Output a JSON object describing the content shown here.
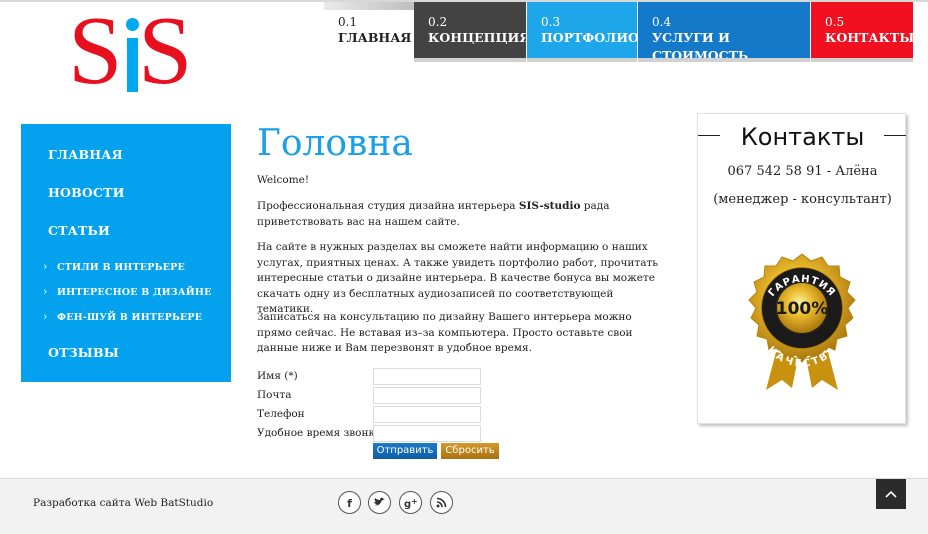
{
  "logo": {
    "text": "SiS"
  },
  "topnav": [
    {
      "num": "0.1",
      "label": "ГЛАВНАЯ"
    },
    {
      "num": "0.2",
      "label": "КОНЦЕПЦИЯ"
    },
    {
      "num": "0.3",
      "label": "ПОРТФОЛИО"
    },
    {
      "num": "0.4",
      "label": "УСЛУГИ И СТОИМОСТЬ"
    },
    {
      "num": "0.5",
      "label": "КОНТАКТЫ"
    }
  ],
  "sidebar": {
    "items": [
      {
        "label": "ГЛАВНАЯ"
      },
      {
        "label": "НОВОСТИ"
      },
      {
        "label": "СТАТЬИ"
      },
      {
        "label": "ОТЗЫВЫ"
      }
    ],
    "subitems": [
      {
        "label": "СТИЛИ В ИНТЕРЬЕРЕ"
      },
      {
        "label": "ИНТЕРЕСНОЕ В ДИЗАЙНЕ"
      },
      {
        "label": "ФЕН-ШУЙ В ИНТЕРЬЕРЕ"
      }
    ]
  },
  "main": {
    "title": "Головна",
    "welcome": "Welcome!",
    "p1_before": "Профессиональная студия дизайна интерьера ",
    "p1_brand": "SIS-studio",
    "p1_after": " рада приветствовать вас на нашем сайте.",
    "p2": "На сайте в нужных разделах вы сможете найти информацию о наших услугах, приятных ценах.    А также увидеть портфолио работ, прочитать интересные статьи о дизайне интерьера. В качестве бонуса вы можете скачать одну из бесплатных аудиозаписей по соответствующей тематики.",
    "p3": "Записаться на консультацию по дизайну Вашего интерьера можно прямо сейчас.  Не вставая из–за компьютера. Просто  оставьте свои данные ниже и Вам перезвонят в удобное время."
  },
  "form": {
    "name_label": "Имя (*)",
    "email_label": "Почта",
    "phone_label": "Телефон",
    "time_label": "Удобное время звонка",
    "name_value": "",
    "email_value": "",
    "phone_value": "",
    "time_value": "",
    "submit_label": "Отправить",
    "reset_label": "Сбросить"
  },
  "contacts": {
    "title": "Контакты",
    "phone": "067 542 58 91 - Алёна",
    "role": "(менеджер - консультант)",
    "seal_top": "ГАРАНТИЯ",
    "seal_center": "100%",
    "seal_bottom": "КАЧЕСТВА"
  },
  "footer": {
    "credit": "Разработка сайта Web BatStudio",
    "social_icons": [
      "facebook-icon",
      "twitter-icon",
      "google-plus-icon",
      "rss-icon"
    ]
  },
  "colors": {
    "brand_red": "#e8101e",
    "brand_blue": "#04a2ee",
    "nav_dark": "#434343",
    "nav_blue": "#1579c9",
    "nav_red": "#f0101f",
    "gold": "#d8a51c"
  }
}
